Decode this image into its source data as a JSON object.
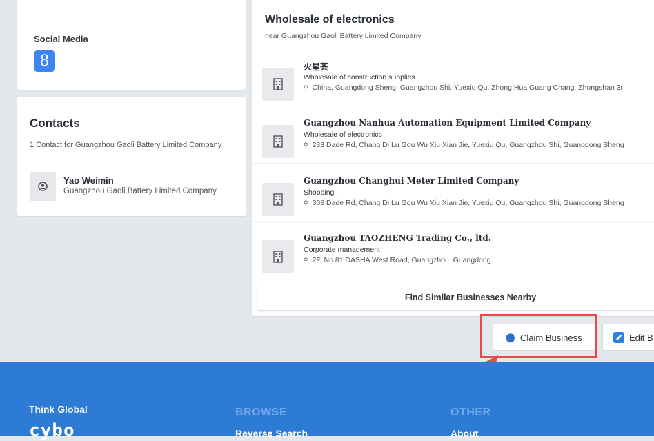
{
  "social": {
    "title": "Social Media",
    "icon": "google-plus-icon",
    "glyph": "8"
  },
  "contacts": {
    "title": "Contacts",
    "subtitle": "1 Contact for Guangzhou Gaoli Battery Limited Company",
    "items": [
      {
        "name": "Yao Weimin",
        "company": "Guangzhou Gaoli Battery Limited Company",
        "icon": "user-icon"
      }
    ]
  },
  "nearby": {
    "title": "Wholesale of electronics",
    "subtitle": "near Guangzhou Gaoli Battery Limited Company",
    "businesses": [
      {
        "name": "火星荟",
        "category": "Wholesale of construction supplies",
        "address": "China, Guangdong Sheng, Guangzhou Shi, Yuexiu Qu, Zhong Hua Guang Chang, Zhongshan 3r"
      },
      {
        "name": "Guangzhou Nanhua Automation Equipment Limited Company",
        "category": "Wholesale of electronics",
        "address": "233 Dade Rd, Chang Di Lu Gou Wu Xiu Xian Jie, Yuexiu Qu, Guangzhou Shi, Guangdong Sheng"
      },
      {
        "name": "Guangzhou Changhui Meter Limited Company",
        "category": "Shopping",
        "address": "308 Dade Rd, Chang Di Lu Gou Wu Xiu Xian Jie, Yuexiu Qu, Guangzhou Shi, Guangdong Sheng"
      },
      {
        "name": "Guangzhou TAOZHENG Trading Co., ltd.",
        "category": "Corporate management",
        "address": "2F, No.81 DASHA West Road, Guangzhou, Guangdong"
      }
    ],
    "find_similar_label": "Find Similar Businesses Nearby"
  },
  "actions": {
    "claim_label": "Claim Business",
    "edit_label": "Edit B"
  },
  "footer": {
    "tagline": "Think Global",
    "logo": "cybo",
    "browse_title": "BROWSE",
    "browse_link": "Reverse Search",
    "other_title": "OTHER",
    "other_link": "About"
  },
  "colors": {
    "accent": "#2e7bd6",
    "highlight": "#e8494a",
    "google": "#3d85f0"
  }
}
